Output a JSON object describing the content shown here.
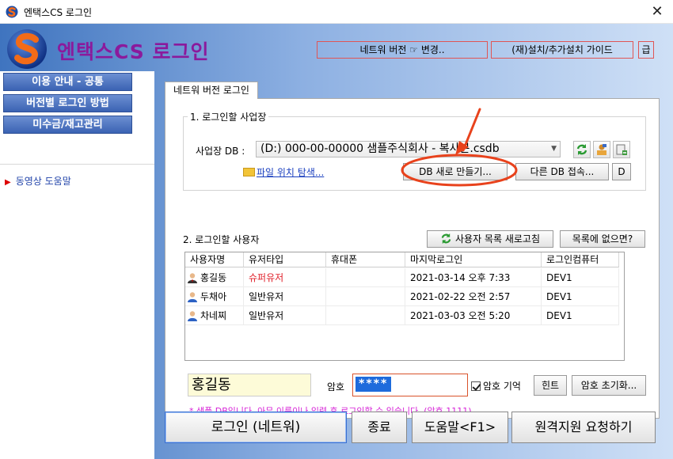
{
  "window": {
    "title": "엔택스CS 로그인",
    "close_glyph": "✕"
  },
  "header": {
    "app_title": "엔택스CS 로그인",
    "network_button": "네트워 버전 ☞ 변경..",
    "setup_button": "(재)설치/추가설치 가이드",
    "extra_button": "급"
  },
  "sidebar": {
    "items": [
      {
        "label": "이용 안내 - 공통"
      },
      {
        "label": "버전별 로그인 방법"
      },
      {
        "label": "미수금/재고관리"
      }
    ],
    "video_link": "동영상 도움말"
  },
  "tab": {
    "label": "네트워 버전 로그인"
  },
  "section1": {
    "title": "1. 로그인할 사업장",
    "db_label": "사업장 DB :",
    "db_value": "(D:) 000-00-00000 샘플주식회사 - 복사본.csdb",
    "file_link": "파일 위치 탐색...",
    "new_db_button": "DB 새로 만들기...",
    "other_db_button": "다른 DB 접속...",
    "d_button": "D"
  },
  "section2": {
    "title": "2. 로그인할 사용자",
    "refresh_button": "사용자 목록 새로고침",
    "not_listed_button": "목록에 없으면?",
    "columns": [
      "사용자명",
      "유저타입",
      "휴대폰",
      "마지막로그인",
      "로그인컴퓨터"
    ],
    "rows": [
      {
        "name": "홍길동",
        "type": "슈퍼유저",
        "phone": "",
        "last_login": "2021-03-14 오후 7:33",
        "computer": "DEV1"
      },
      {
        "name": "두채아",
        "type": "일반유저",
        "phone": "",
        "last_login": "2021-02-22 오전 2:57",
        "computer": "DEV1"
      },
      {
        "name": "차네찌",
        "type": "일반유저",
        "phone": "",
        "last_login": "2021-03-03 오전 5:20",
        "computer": "DEV1"
      }
    ]
  },
  "login": {
    "username": "홍길동",
    "password_label": "암호",
    "password_mask": "****",
    "remember_label": "암호 기억",
    "hint_button": "힌트",
    "reset_button": "암호 초기화...",
    "notice": "* 샘플 DB입니다. 아무 이름이나 입력 후 로그인할 수 있습니다. (암호 1111)"
  },
  "footer": {
    "login_button": "로그인 (네트워)",
    "exit_button": "종료",
    "help_button": "도움말<F1>",
    "remote_button": "원격지원 요청하기"
  },
  "colors": {
    "title_purple": "#8b1a9c",
    "menu_blue": "#3b63b3",
    "annotation_red": "#e8421c",
    "notice_magenta": "#d61fd6",
    "superuser_red": "#e0202a"
  }
}
